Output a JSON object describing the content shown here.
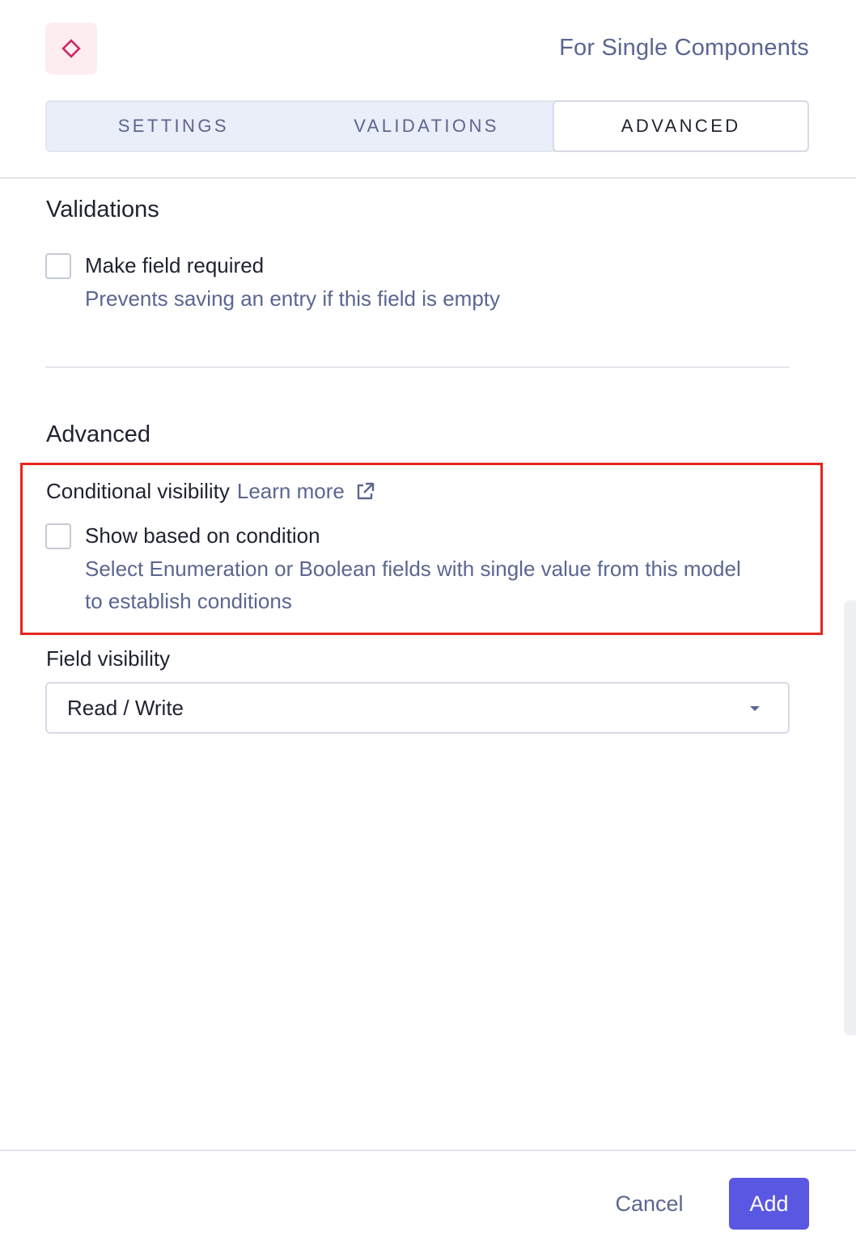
{
  "header": {
    "icon": "diamond-icon",
    "title": "For Single Components"
  },
  "tabs": [
    {
      "label": "SETTINGS",
      "active": false
    },
    {
      "label": "VALIDATIONS",
      "active": false
    },
    {
      "label": "ADVANCED",
      "active": true
    }
  ],
  "validations": {
    "title": "Validations",
    "required": {
      "label": "Make field required",
      "help": "Prevents saving an entry if this field is empty",
      "checked": false
    }
  },
  "advanced": {
    "title": "Advanced",
    "conditional_visibility": {
      "heading": "Conditional visibility",
      "learn_more": "Learn more",
      "link_icon": "external-link-icon",
      "option": {
        "label": "Show based on condition",
        "help_line1": "Select Enumeration or Boolean fields with single value from this model",
        "help_line2": "to establish conditions",
        "checked": false
      }
    },
    "field_visibility": {
      "label": "Field visibility",
      "value": "Read / Write"
    }
  },
  "footer": {
    "cancel": "Cancel",
    "add": "Add"
  },
  "colors": {
    "accent": "#5a57e3",
    "highlight": "#e8251c",
    "icon": "#d02660",
    "muted_text": "#5b6690"
  }
}
